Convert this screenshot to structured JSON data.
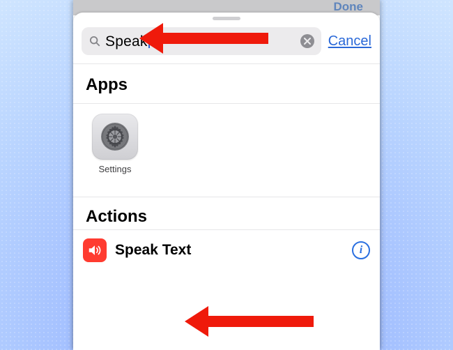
{
  "behind": {
    "done_label": "Done"
  },
  "search": {
    "value": "Speak",
    "clear_aria": "Clear text",
    "cancel_label": "Cancel"
  },
  "sections": {
    "apps_header": "Apps",
    "actions_header": "Actions"
  },
  "apps": [
    {
      "label": "Settings",
      "icon": "settings-gear"
    }
  ],
  "actions": [
    {
      "label": "Speak Text",
      "icon": "speaker-icon",
      "tint": "#ff3b30"
    }
  ],
  "info_glyph": "i",
  "colors": {
    "ios_blue": "#2a6fe0",
    "destructive_red": "#ff3b30",
    "arrow_red": "#ef1a0b"
  }
}
